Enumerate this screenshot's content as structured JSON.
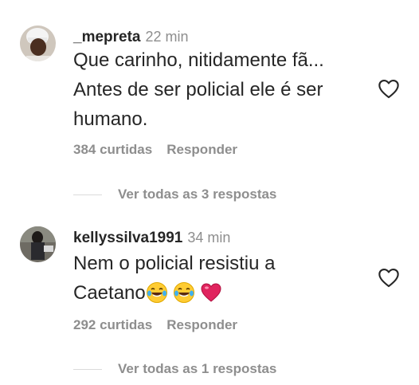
{
  "comments": [
    {
      "username": "_mepreta",
      "time": "22 min",
      "lines": [
        "Que carinho, nitidamente fã...",
        "Antes de ser policial ele é ser",
        "humano."
      ],
      "likes": "384 curtidas",
      "reply": "Responder",
      "view_replies": "Ver todas as 3 respostas",
      "avatar_icon": "avatar-chef-photo"
    },
    {
      "username": "kellyssilva1991",
      "time": "34 min",
      "lines": [
        "Nem o policial resistiu a",
        "Caetano"
      ],
      "emojis": [
        "laughing-tears-emoji",
        "laughing-tears-emoji",
        "red-heart-emoji"
      ],
      "likes": "292 curtidas",
      "reply": "Responder",
      "view_replies": "Ver todas as 1 respostas",
      "avatar_icon": "avatar-person-photo"
    }
  ],
  "colors": {
    "text": "#262626",
    "secondary": "#8e8e8e",
    "heart_emoji": "#e0245e"
  }
}
